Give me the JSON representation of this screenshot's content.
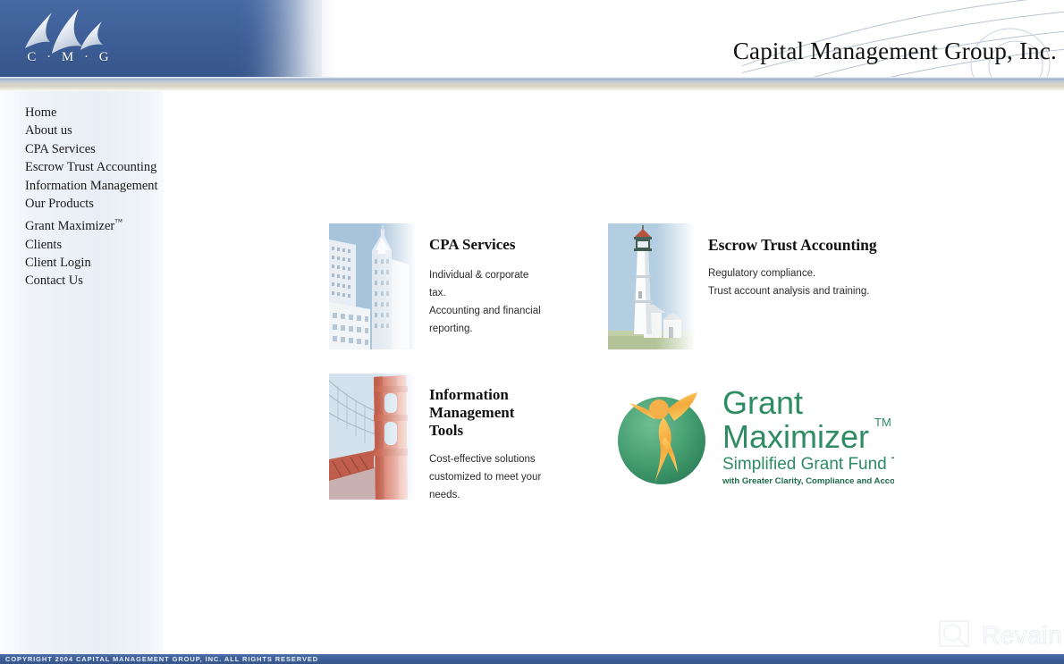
{
  "header": {
    "logo_letters": "C · M · G",
    "company_name": "Capital Management Group, Inc.",
    "brand_blue": "#3d5e97",
    "band_tan": "#d9d5c6"
  },
  "sidebar": {
    "items": [
      {
        "label": "Home"
      },
      {
        "label": "About us"
      },
      {
        "label": "CPA Services"
      },
      {
        "label": "Escrow Trust Accounting"
      },
      {
        "label": "Information Management"
      },
      {
        "label": "Our Products"
      },
      {
        "label": "Grant Maximizer",
        "tm": "™"
      },
      {
        "label": "Clients"
      },
      {
        "label": "Client Login"
      },
      {
        "label": "Contact Us"
      }
    ]
  },
  "main": {
    "cards": [
      {
        "id": "cpa",
        "title": "CPA Services",
        "desc_lines": [
          "Individual & corporate tax.",
          "Accounting and financial",
          "reporting."
        ],
        "image": "chrysler-building-photo"
      },
      {
        "id": "escrow",
        "title": "Escrow Trust Accounting",
        "desc_lines": [
          "Regulatory compliance.",
          "Trust account analysis and training."
        ],
        "image": "lighthouse-photo"
      },
      {
        "id": "infomgmt",
        "title_line1": "Information",
        "title_line2": "Management Tools",
        "desc_lines": [
          "Cost-effective solutions",
          "customized to meet your needs."
        ],
        "image": "golden-gate-bridge-photo"
      },
      {
        "id": "grant",
        "logo": {
          "word1": "Grant",
          "word2": "Maximizer",
          "tm": "TM",
          "tagline": "Simplified Grant Fund Tracking",
          "subtagline": "with Greater Clarity, Compliance and Accountability",
          "green": "#2e8b63",
          "accent": "#f6b53f"
        }
      }
    ]
  },
  "watermark": {
    "text": "Revain",
    "icon": "magnifier-icon"
  },
  "footer": {
    "copyright": "COPYRIGHT 2004 CAPITAL MANAGEMENT GROUP, INC. ALL RIGHTS RESERVED"
  }
}
